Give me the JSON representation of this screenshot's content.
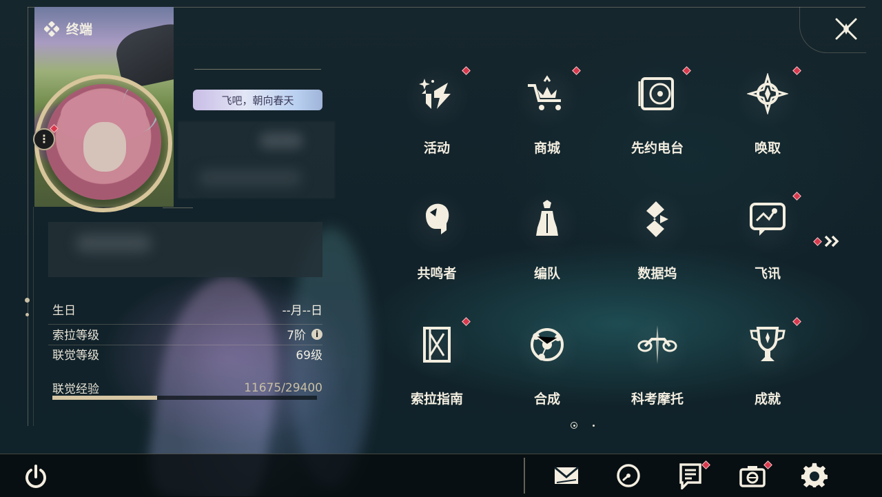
{
  "header": {
    "title": "终端"
  },
  "profile": {
    "signature_banner": "飞吧，朝向春天",
    "stats": [
      {
        "label": "生日",
        "value": "--月--日"
      },
      {
        "label": "索拉等级",
        "value": "7阶"
      },
      {
        "label": "联觉等级",
        "value": "69级"
      }
    ],
    "exp": {
      "label": "联觉经验",
      "value": "11675/29400",
      "current": 11675,
      "max": 29400
    }
  },
  "menu": {
    "items": [
      {
        "label": "活动",
        "icon": "activity-icon",
        "badge": true
      },
      {
        "label": "商城",
        "icon": "shop-crown-cart-icon",
        "badge": true
      },
      {
        "label": "先约电台",
        "icon": "radio-record-icon",
        "badge": true
      },
      {
        "label": "唤取",
        "icon": "convene-star-icon",
        "badge": true
      },
      {
        "label": "共鸣者",
        "icon": "resonator-head-icon",
        "badge": false
      },
      {
        "label": "编队",
        "icon": "chess-team-icon",
        "badge": false
      },
      {
        "label": "数据坞",
        "icon": "databank-icon",
        "badge": false
      },
      {
        "label": "飞讯",
        "icon": "chat-message-icon",
        "badge": true
      },
      {
        "label": "索拉指南",
        "icon": "guidebook-icon",
        "badge": true
      },
      {
        "label": "合成",
        "icon": "synthesis-orbit-icon",
        "badge": false
      },
      {
        "label": "科考摩托",
        "icon": "motorbike-icon",
        "badge": false
      },
      {
        "label": "成就",
        "icon": "trophy-icon",
        "badge": true
      }
    ],
    "next_page_badge": true,
    "page_count": 2,
    "current_page": 1
  },
  "bottom_bar": {
    "icons": [
      "power-icon",
      "mail-icon",
      "clock-icon",
      "notice-icon",
      "camera-icon",
      "settings-gear-icon"
    ]
  },
  "colors": {
    "accent_gold": "#d7c59b",
    "badge_red": "#d8394c",
    "text": "#f3eee0"
  }
}
